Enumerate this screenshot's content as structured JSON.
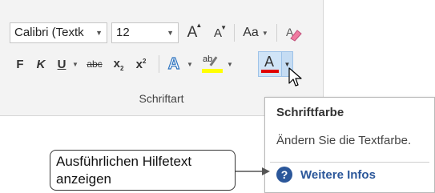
{
  "ribbon": {
    "font_name": "Calibri (Textk",
    "font_size": "12",
    "grow_font": "A",
    "shrink_font": "A",
    "change_case": "Aa",
    "bold": "F",
    "italic": "K",
    "underline": "U",
    "strikethrough": "abc",
    "subscript": "x",
    "subscript_mark": "2",
    "superscript": "x",
    "superscript_mark": "2",
    "text_effects": "A",
    "highlight": "ab",
    "font_color": "A",
    "group_name": "Schriftart"
  },
  "colors": {
    "highlight_color": "#ffff00",
    "font_color_bar": "#e00000",
    "effects_color": "#2e74c0",
    "link_color": "#2b579a"
  },
  "tooltip": {
    "title": "Schriftfarbe",
    "description": "Ändern Sie die Textfarbe.",
    "more_info": "Weitere Infos",
    "help_icon_glyph": "?"
  },
  "callout": {
    "line1": "Ausführlichen Hilfetext",
    "line2": "anzeigen"
  }
}
